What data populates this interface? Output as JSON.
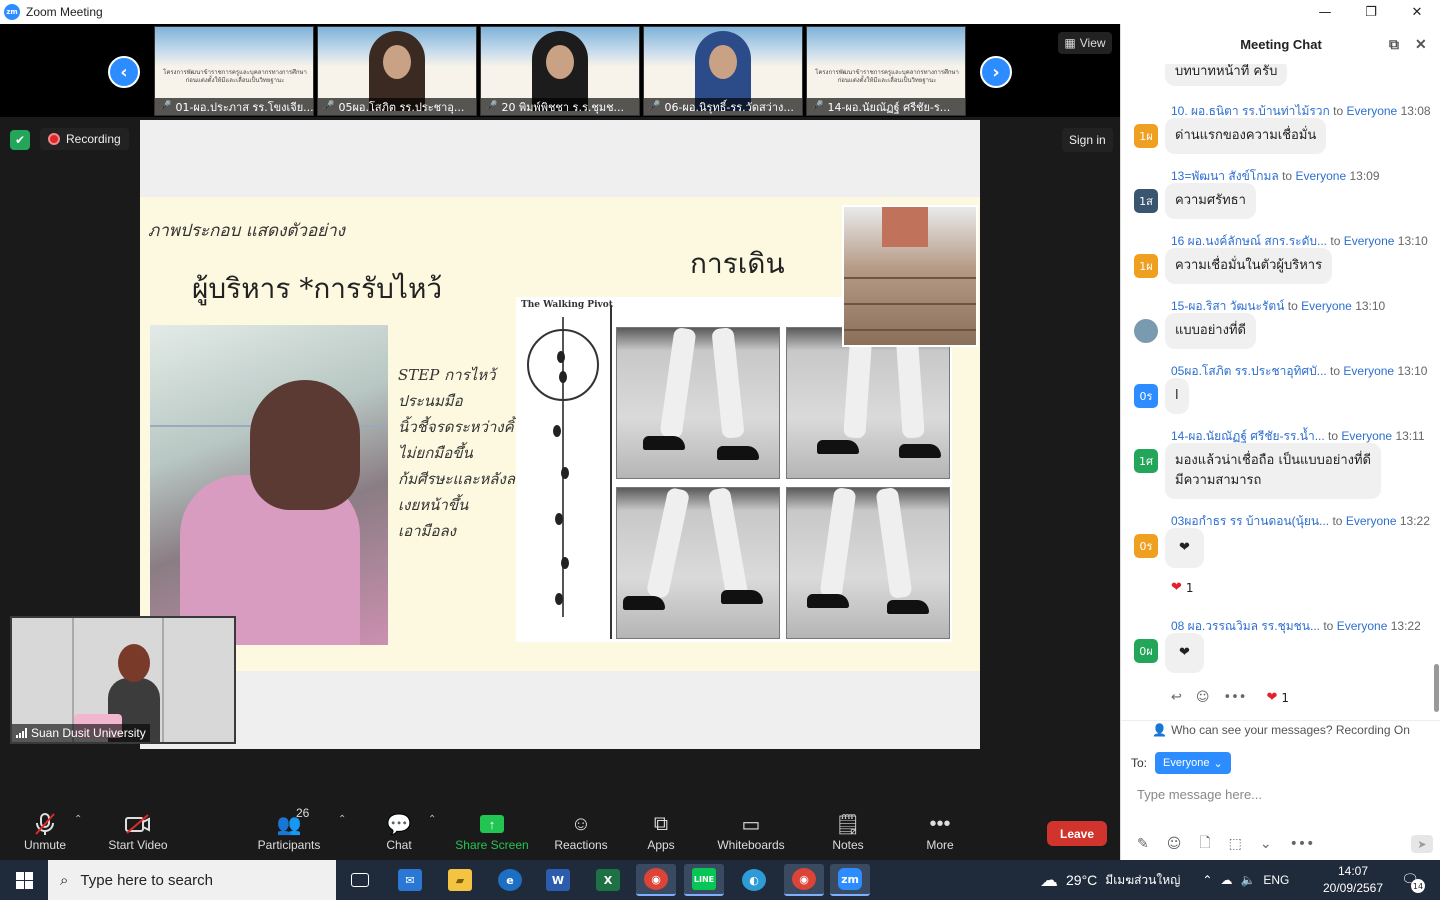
{
  "window": {
    "title": "Zoom Meeting",
    "logo_text": "zm",
    "minimize": "—",
    "maximize": "❐",
    "close": "✕"
  },
  "gallery": {
    "prev": "‹",
    "next": "›",
    "view_label": "View",
    "banner_text": "โครงการพัฒนาข้าราชการครูและบุคลากรทางการศึกษา ก่อนแต่งตั้งให้มีและเลื่อนเป็นวิทยฐานะ",
    "thumbnails": [
      {
        "name": "01-ผอ.ประภาส รร.โขงเจีย..."
      },
      {
        "name": "05ผอ.โสภิต  รร.ประชาอุ..."
      },
      {
        "name": "20 พิมพ์พิชชา ร.ร.ชุมช..."
      },
      {
        "name": "06-ผอ.นิรุทธิ์-รร.วัดสว่าง..."
      },
      {
        "name": "14-ผอ.นัยณัฏฐ์ ศรีชัย-ร..."
      }
    ]
  },
  "status": {
    "recording_label": "Recording",
    "signin_label": "Sign in"
  },
  "slide": {
    "caption": "ภาพประกอบ แสดงตัวอย่าง",
    "heading_left": "ผู้บริหาร *การรับไหว้",
    "heading_right": "การเดิน",
    "steps": [
      "STEP การไหว้",
      "ประนมมือ",
      "นิ้วชี้จรดระหว่างคิ้ว",
      "ไม่ยกมือขึ้น",
      "ก้มศีรษะและหลังลง",
      "เงยหน้าขึ้น",
      "เอามือลง"
    ],
    "walk_title": "The Walking Pivot"
  },
  "selfview": {
    "name": "Suan Dusit University"
  },
  "toolbar": {
    "unmute": "Unmute",
    "start_video": "Start Video",
    "participants": "Participants",
    "participant_count": "26",
    "chat": "Chat",
    "share_screen": "Share Screen",
    "reactions": "Reactions",
    "apps": "Apps",
    "whiteboards": "Whiteboards",
    "notes": "Notes",
    "more": "More",
    "leave": "Leave"
  },
  "chat": {
    "title": "Meeting Chat",
    "partial_top": "บทบาทหน้าที่ ครับ",
    "to_label": "to",
    "messages": [
      {
        "sender": "10. ผอ.ธนิตา รร.บ้านท่าไม้รวก",
        "to": "Everyone",
        "time": "13:08",
        "avatar": "1ผ",
        "avatar_color": "#f0a020",
        "text": "ด่านแรกของความเชื่อมั่น"
      },
      {
        "sender": "13=พัฒนา สังข์โกมล",
        "to": "Everyone",
        "time": "13:09",
        "avatar": "1ส",
        "avatar_color": "#3a5570",
        "text": "ความศรัทธา"
      },
      {
        "sender": "16 ผอ.นงค์ลักษณ์ สกร.ระดับ...",
        "to": "Everyone",
        "time": "13:10",
        "avatar": "1ผ",
        "avatar_color": "#f0a020",
        "text": "ความเชื่อมั่นในตัวผู้บริหาร"
      },
      {
        "sender": "15-ผอ.ริสา วัฒนะรัตน์",
        "to": "Everyone",
        "time": "13:10",
        "avatar": "",
        "avatar_color": "#7a9ab0",
        "text": "แบบอย่างที่ดี"
      },
      {
        "sender": "05ผอ.โสภิต  รร.ประชาอุทิศบั...",
        "to": "Everyone",
        "time": "13:10",
        "avatar": "0ร",
        "avatar_color": "#2d8cff",
        "text": "l"
      },
      {
        "sender": "14-ผอ.นัยณัฏฐ์ ศรีชัย-รร.น้ำ...",
        "to": "Everyone",
        "time": "13:11",
        "avatar": "1ศ",
        "avatar_color": "#23a55a",
        "text": "มองแล้วน่าเชื่อถือ เป็นแบบอย่างที่ดี",
        "text2": "มีความสามารถ"
      },
      {
        "sender": "03ผอกำธร รร บ้านดอน(นุ้ยน...",
        "to": "Everyone",
        "time": "13:22",
        "avatar": "0ร",
        "avatar_color": "#f0a020",
        "text": "❤",
        "reaction_count": "1"
      },
      {
        "sender": "08 ผอ.วรรณวิมล   รร.ชุมชน...",
        "to": "Everyone",
        "time": "13:22",
        "avatar": "0ผ",
        "avatar_color": "#23a55a",
        "text": "❤",
        "reaction_count": "1"
      }
    ],
    "who_can_see": "Who can see your messages? Recording On",
    "to_field_label": "To:",
    "to_recipient": "Everyone",
    "input_placeholder": "Type message here..."
  },
  "taskbar": {
    "search_placeholder": "Type here to search",
    "temperature": "29°C",
    "weather_text": "มีเมฆส่วนใหญ่",
    "language": "ENG",
    "time": "14:07",
    "date": "20/09/2567",
    "notification_count": "14"
  }
}
